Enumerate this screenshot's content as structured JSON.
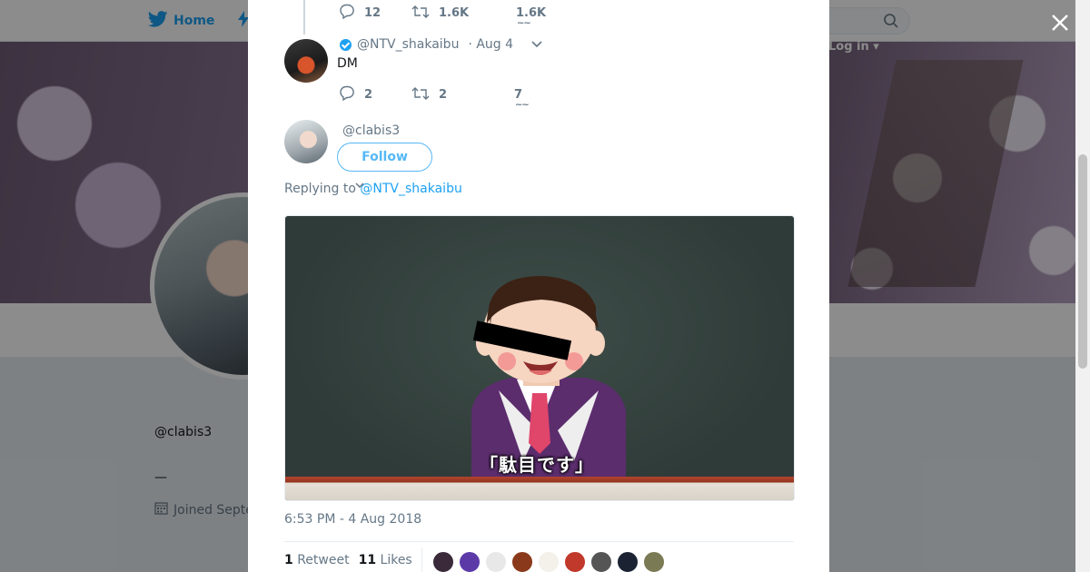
{
  "nav": {
    "home_label": "Home",
    "login_label": "Log in",
    "brand_color": "#1da1f2"
  },
  "profile_background": {
    "handle": "@clabis3",
    "dash": "—",
    "joined": "Joined Septe"
  },
  "thread": [
    {
      "counts": {
        "replies": "12",
        "retweets": "1.6K",
        "likes": "1.6K"
      }
    },
    {
      "handle": "@NTV_shakaibu",
      "verified": true,
      "date": "· Aug 4",
      "text": "DM",
      "counts": {
        "replies": "2",
        "retweets": "2",
        "likes": "7"
      }
    }
  ],
  "main_tweet": {
    "handle": "@clabis3",
    "follow_label": "Follow",
    "replying_prefix": "Replying to",
    "replying_to": "@NTV_shakaibu",
    "media_caption": "「駄目です」",
    "timestamp": "6:53 PM - 4 Aug 2018",
    "retweet_count": "1",
    "retweet_label": "Retweet",
    "like_count": "11",
    "like_label": "Likes"
  },
  "likers": [
    {
      "icon": "liker-avatar-1",
      "color": "#3a2a3a"
    },
    {
      "icon": "liker-avatar-2",
      "color": "#5b3aa8"
    },
    {
      "icon": "liker-avatar-3",
      "color": "#e8e8e8"
    },
    {
      "icon": "liker-avatar-4",
      "color": "#8a3a1a"
    },
    {
      "icon": "liker-avatar-5",
      "color": "#f4f0ea"
    },
    {
      "icon": "liker-avatar-6",
      "color": "#c0392b"
    },
    {
      "icon": "liker-avatar-7",
      "color": "#555555"
    },
    {
      "icon": "liker-avatar-8",
      "color": "#1b2333"
    },
    {
      "icon": "liker-avatar-9",
      "color": "#7a7a55"
    }
  ]
}
